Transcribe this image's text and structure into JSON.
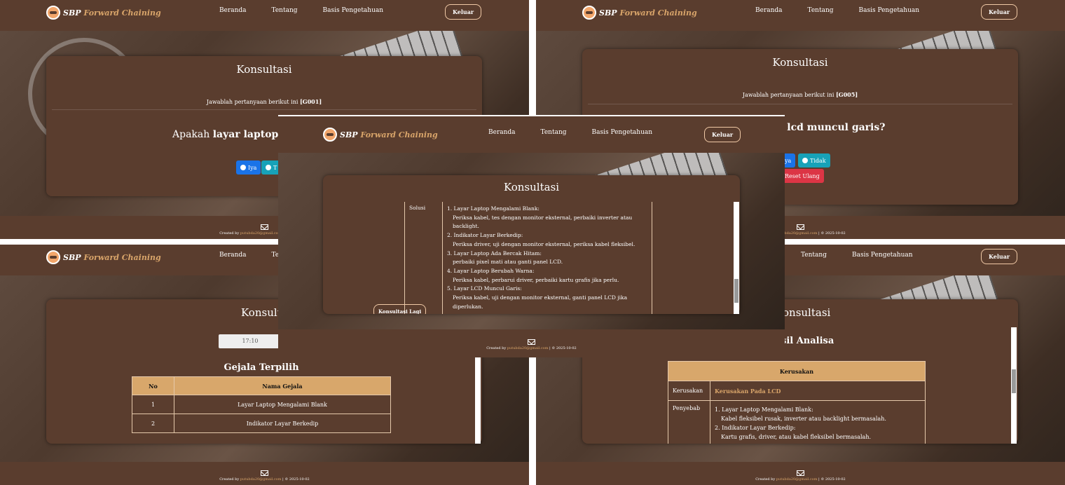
{
  "nav": {
    "brand_name": "SBP",
    "brand_accent": "Forward Chaining",
    "links": [
      "Beranda",
      "Tentang",
      "Basis Pengetahuan"
    ],
    "logout": "Keluar"
  },
  "page_title": "Konsultasi",
  "footer": {
    "prefix": "Created by",
    "email": "putubda20@gmail.com",
    "suffix": "| © 2025-10-02"
  },
  "panel1": {
    "prompt": "Jawablah pertanyaan berikut ini",
    "code": "[G001]",
    "question_prefix": "Apakah",
    "question_bold": "layar laptop m",
    "yes": "Iya",
    "no": "T"
  },
  "panel2": {
    "prompt": "Jawablah pertanyaan berikut ini",
    "code": "[G005]",
    "question_visible": "r lcd muncul garis?",
    "yes": "ya",
    "no": "Tidak",
    "reset": "Reset Ulang"
  },
  "panel3": {
    "time": "17:10",
    "heading": "Gejala Terpilih",
    "col_no": "No",
    "col_name": "Nama Gejala",
    "rows": [
      {
        "no": "1",
        "name": "Layar Laptop Mengalami Blank"
      },
      {
        "no": "2",
        "name": "Indikator Layar Berkedip"
      }
    ],
    "title_visible": "Konsulta"
  },
  "panel4": {
    "title_visible": "onsultasi",
    "heading_visible": "sil Analisa",
    "header": "Kerusakan",
    "label_damage": "Kerusakan",
    "damage": "Kerusakan Pada LCD",
    "label_cause": "Penyebab",
    "causes": [
      {
        "title": "1. Layar Laptop Mengalami Blank:",
        "desc": "Kabel fleksibel rusak, inverter atau backlight bermasalah."
      },
      {
        "title": "2. Indikator Layar Berkedip:",
        "desc": "Kartu grafis, driver, atau kabel fleksibel bermasalah."
      }
    ]
  },
  "panel5": {
    "label": "Solusi",
    "items": [
      {
        "title": "1. Layar Laptop Mengalami Blank:",
        "desc": "Periksa kabel, tes dengan monitor eksternal, perbaiki inverter atau backlight."
      },
      {
        "title": "2. Indikator Layar Berkedip:",
        "desc": "Periksa driver, uji dengan monitor eksternal, periksa kabel fleksibel."
      },
      {
        "title": "3. Layar Laptop Ada Bercak Hitam:",
        "desc": "perbaiki pixel mati atau ganti panel LCD."
      },
      {
        "title": "4. Layar Laptop Berubah Warna:",
        "desc": "Periksa kabel, perbarui driver, perbaiki kartu grafis jika perlu."
      },
      {
        "title": "5. Layar LCD Muncul Garis:",
        "desc": "Periksa kabel, uji dengan monitor eksternal, ganti panel LCD jika diperlukan."
      }
    ],
    "again": "Konsultasi Lagi"
  },
  "colors": {
    "bg": "#5a3d2e",
    "accent": "#d9a56a",
    "table_header": "#d8a76b",
    "blue": "#1a73e8",
    "teal": "#17a2b8",
    "red": "#dc3545"
  }
}
